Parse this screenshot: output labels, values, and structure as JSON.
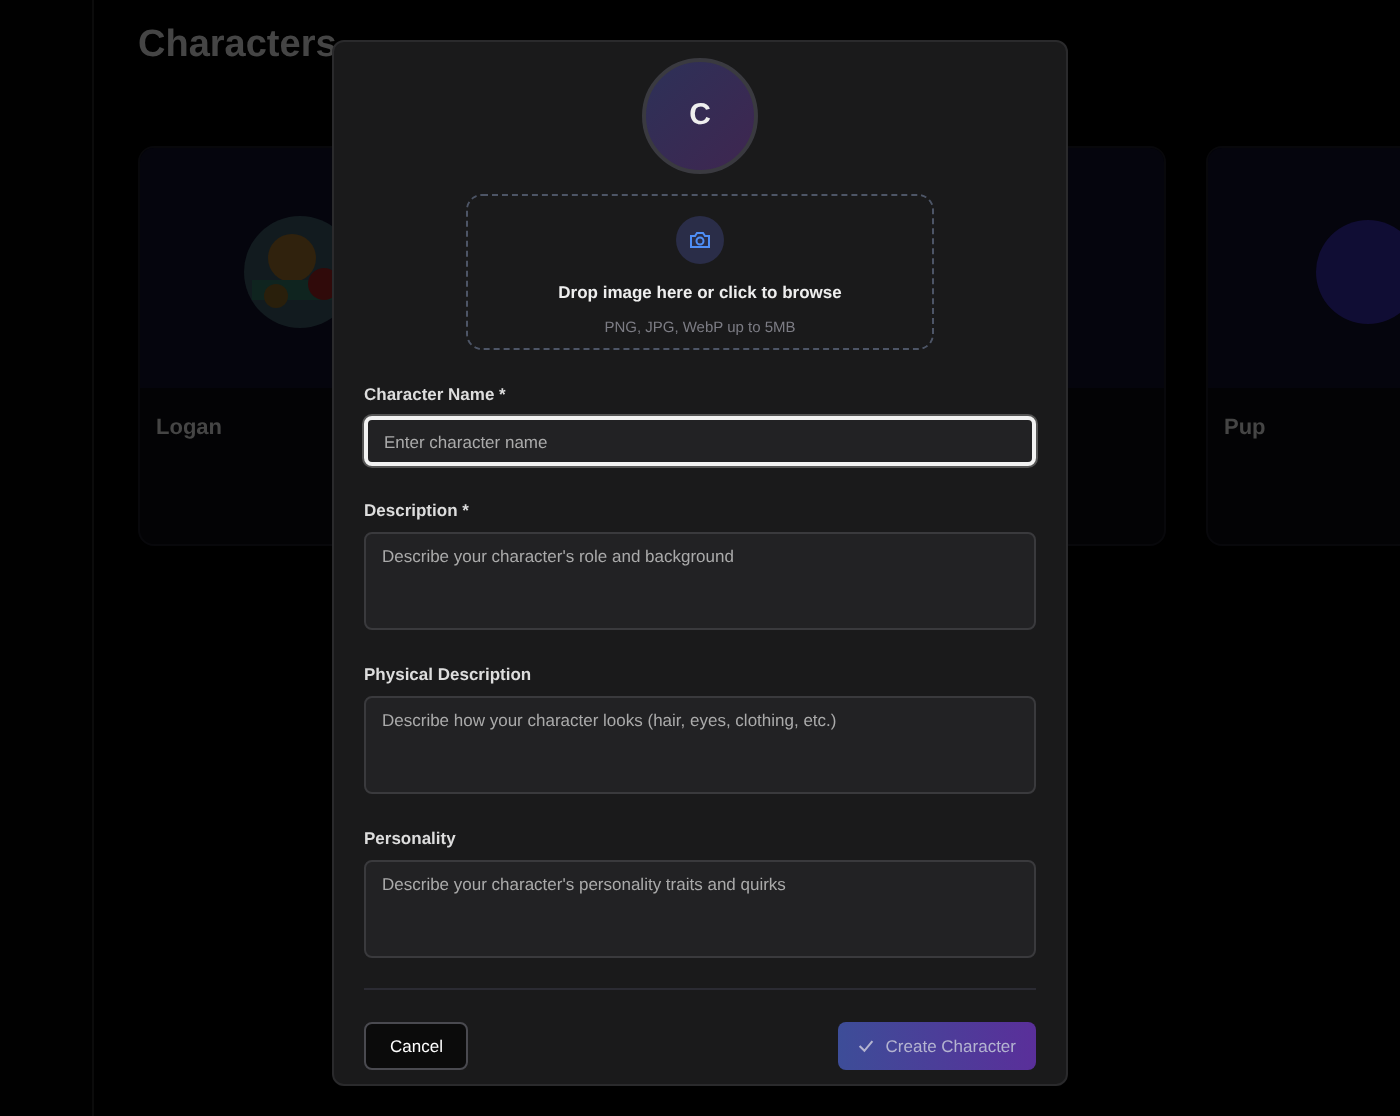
{
  "background": {
    "title": "Characters",
    "cards": [
      {
        "name": "Logan",
        "kind": "picture"
      },
      {
        "kind": "blank"
      },
      {
        "name": "Pup",
        "kind": "avatar"
      }
    ]
  },
  "modal": {
    "avatar_initial": "C",
    "upload": {
      "title": "Drop image here or click to browse",
      "hint": "PNG, JPG, WebP up to 5MB"
    },
    "fields": [
      {
        "label": "Character Name *",
        "placeholder": "Enter character name",
        "kind": "input",
        "focused": true
      },
      {
        "label": "Description *",
        "placeholder": "Describe your character's role and background",
        "kind": "textarea",
        "focused": false
      },
      {
        "label": "Physical Description",
        "placeholder": "Describe how your character looks (hair, eyes, clothing, etc.)",
        "kind": "textarea",
        "focused": false
      },
      {
        "label": "Personality",
        "placeholder": "Describe your character's personality traits and quirks",
        "kind": "textarea",
        "focused": false
      }
    ],
    "buttons": [
      {
        "label": "Cancel",
        "kind": "secondary",
        "disabled": false
      },
      {
        "label": "Create Character",
        "kind": "primary",
        "disabled": true
      }
    ]
  }
}
